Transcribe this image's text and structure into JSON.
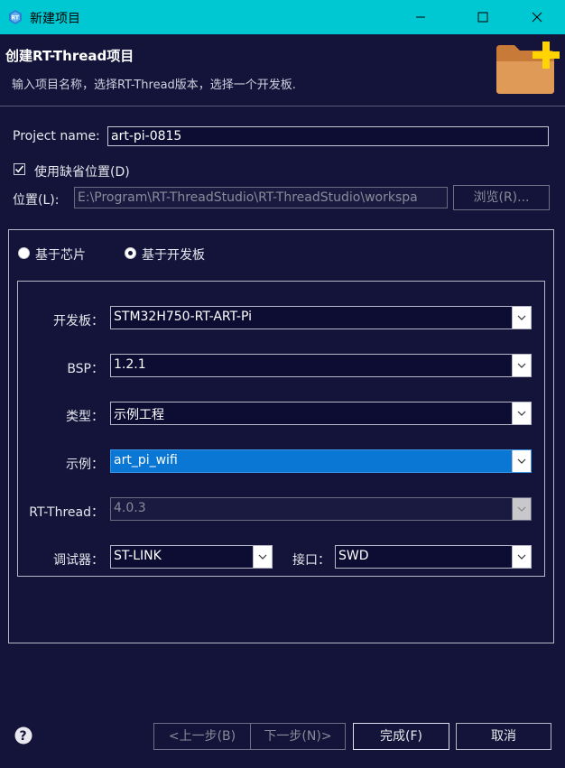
{
  "window": {
    "title": "新建项目",
    "controls": {
      "minimize": "minimize-icon",
      "maximize": "maximize-icon",
      "close": "close-icon"
    }
  },
  "header": {
    "title": "创建RT-Thread项目",
    "description": "输入项目名称，选择RT-Thread版本，选择一个开发板."
  },
  "project": {
    "name_label": "Project name:",
    "name_value": "art-pi-0815",
    "use_default_label": "使用缺省位置(D)",
    "use_default_checked": true,
    "location_label": "位置(L):",
    "location_value": "E:\\Program\\RT-ThreadStudio\\RT-ThreadStudio\\workspa",
    "browse_label": "浏览(R)..."
  },
  "mode": {
    "chip_label": "基于芯片",
    "board_label": "基于开发板",
    "selected": "board"
  },
  "form": {
    "board_label": "开发板：",
    "board_value": "STM32H750-RT-ART-Pi",
    "bsp_label": "BSP：",
    "bsp_value": "1.2.1",
    "type_label": "类型：",
    "type_value": "示例工程",
    "example_label": "示例：",
    "example_value": "art_pi_wifi",
    "rtthread_label": "RT-Thread：",
    "rtthread_value": "4.0.3",
    "debugger_label": "调试器：",
    "debugger_value": "ST-LINK",
    "interface_label": "接口：",
    "interface_value": "SWD"
  },
  "footer": {
    "help_icon": "help-icon",
    "prev_label": "<上一步(B)",
    "next_label": "下一步(N)>",
    "finish_label": "完成(F)",
    "cancel_label": "取消"
  },
  "colors": {
    "titlebar": "#00c8d2",
    "background": "#14143a",
    "highlight": "#0a77d4",
    "folder": "#d9904a",
    "plus": "#ffd400"
  }
}
